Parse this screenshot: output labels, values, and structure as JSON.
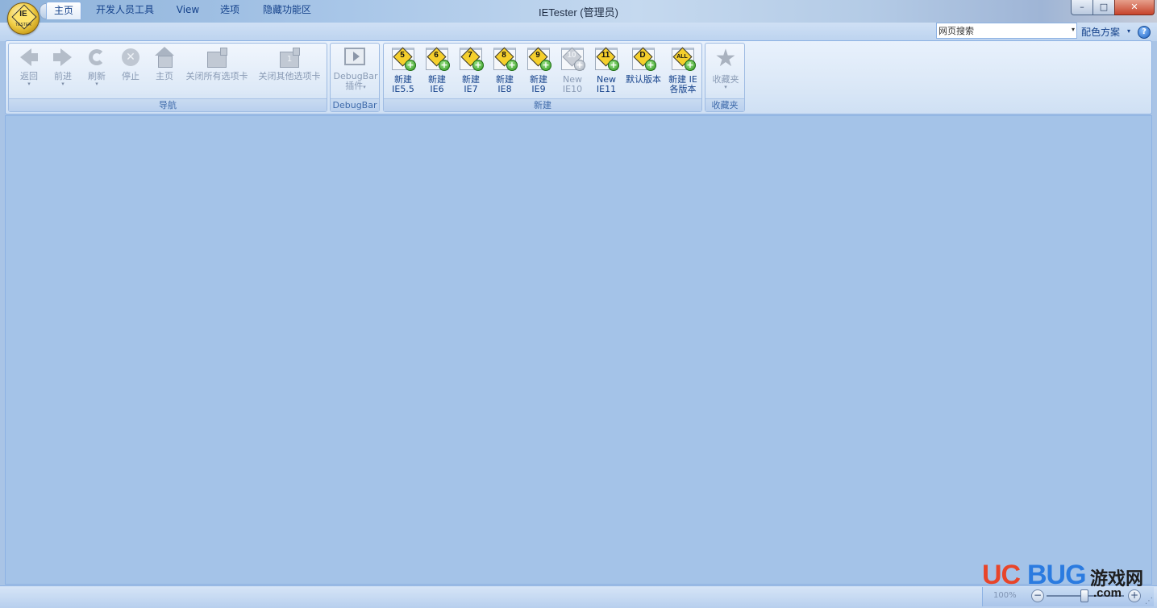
{
  "window": {
    "title": "IETester (管理员)",
    "minimize": "–",
    "maximize": "□",
    "close": "✕"
  },
  "app_button": {
    "logo_text": "IE",
    "logo_sub": "TESTER"
  },
  "quick_access": {
    "dropdown": "▾"
  },
  "tabs": [
    {
      "label": "主页",
      "active": true
    },
    {
      "label": "开发人员工具"
    },
    {
      "label": "View"
    },
    {
      "label": "选项"
    },
    {
      "label": "隐藏功能区"
    }
  ],
  "search": {
    "value": "网页搜索",
    "dropdown": "▾"
  },
  "color_scheme": {
    "label": "配色方案",
    "dropdown": "▾"
  },
  "help": {
    "glyph": "?"
  },
  "groups": {
    "navigation": {
      "label": "导航",
      "buttons": [
        {
          "label": "返回",
          "icon": "back-arrow-icon",
          "dd": "▾"
        },
        {
          "label": "前进",
          "icon": "forward-arrow-icon",
          "dd": "▾"
        },
        {
          "label": "刷新",
          "icon": "refresh-icon",
          "dd": "▾"
        },
        {
          "label": "停止",
          "icon": "stop-icon",
          "glyph": "✕"
        },
        {
          "label": "主页",
          "icon": "home-icon"
        },
        {
          "label": "关闭所有选项卡",
          "icon": "close-all-tabs-icon"
        },
        {
          "label": "关闭其他选项卡",
          "icon": "close-other-tabs-icon",
          "badge": "1"
        }
      ]
    },
    "debugbar": {
      "label": "DebugBar",
      "button": {
        "line1": "DebugBar",
        "line2": "插件",
        "dd": "▾",
        "icon": "debugbar-plugin-icon"
      }
    },
    "new": {
      "label": "新建",
      "buttons": [
        {
          "line1": "新建",
          "line2": "IE5.5",
          "badge": "5"
        },
        {
          "line1": "新建",
          "line2": "IE6",
          "badge": "6"
        },
        {
          "line1": "新建",
          "line2": "IE7",
          "badge": "7"
        },
        {
          "line1": "新建",
          "line2": "IE8",
          "badge": "8"
        },
        {
          "line1": "新建",
          "line2": "IE9",
          "badge": "9"
        },
        {
          "line1": "New",
          "line2": "IE10",
          "badge": "10",
          "disabled": true
        },
        {
          "line1": "New",
          "line2": "IE11",
          "badge": "11"
        },
        {
          "line1": "默认版本",
          "line2": "",
          "badge": "D"
        },
        {
          "line1": "新建 IE",
          "line2": "各版本",
          "badge": "ALL"
        }
      ],
      "plus": "+"
    },
    "favorites": {
      "label": "收藏夹",
      "button": {
        "label": "收藏夹",
        "dd": "▾",
        "glyph": "★",
        "icon": "favorites-star-icon"
      }
    }
  },
  "statusbar": {
    "zoom": "100%",
    "zoom_out": "−",
    "zoom_in": "+",
    "grip": "⋰"
  },
  "watermark": {
    "uc": "UC",
    "bug": "BUG",
    "cn": "游戏网",
    "com": ".com"
  },
  "colors": {
    "accent": "#15428b",
    "content_bg": "#a4c3e8",
    "ribbon_border": "#8db2e3"
  }
}
